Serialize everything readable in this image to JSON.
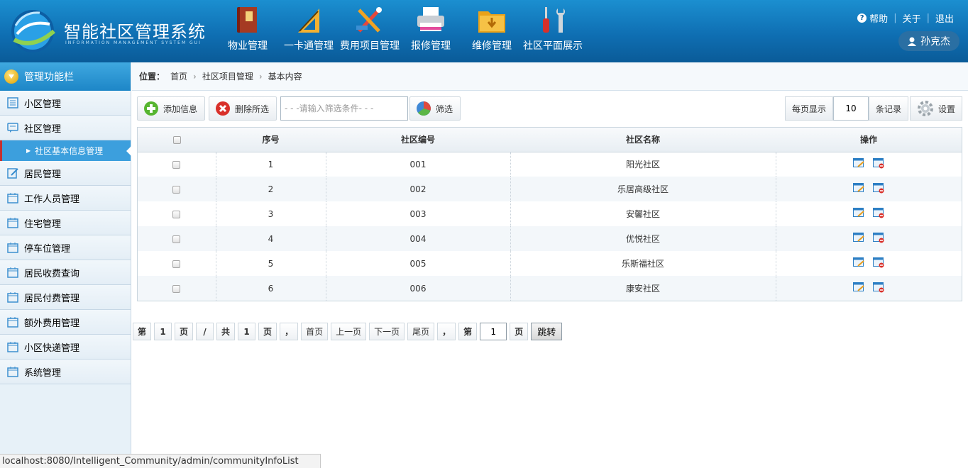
{
  "app": {
    "title": "智能社区管理系统",
    "subtitle": "INFORMATION MANAGEMENT SYSTEM GUI"
  },
  "topnav": [
    {
      "label": "物业管理",
      "icon": "book-icon"
    },
    {
      "label": "一卡通管理",
      "icon": "ruler-icon"
    },
    {
      "label": "费用项目管理",
      "icon": "tools-icon"
    },
    {
      "label": "报修管理",
      "icon": "printer-icon"
    },
    {
      "label": "维修管理",
      "icon": "folder-icon"
    },
    {
      "label": "社区平面展示",
      "icon": "screwdriver-icon"
    }
  ],
  "toplinks": {
    "help": "帮助",
    "about": "关于",
    "logout": "退出"
  },
  "user": {
    "name": "孙克杰"
  },
  "sidebar": {
    "title": "管理功能栏",
    "items": [
      {
        "label": "小区管理"
      },
      {
        "label": "社区管理"
      },
      {
        "label": "居民管理"
      },
      {
        "label": "工作人员管理"
      },
      {
        "label": "住宅管理"
      },
      {
        "label": "停车位管理"
      },
      {
        "label": "居民收费查询"
      },
      {
        "label": "居民付费管理"
      },
      {
        "label": "额外费用管理"
      },
      {
        "label": "小区快递管理"
      },
      {
        "label": "系统管理"
      }
    ],
    "active_sub": "社区基本信息管理"
  },
  "breadcrumb": {
    "label": "位置：",
    "items": [
      "首页",
      "社区项目管理",
      "基本内容"
    ]
  },
  "toolbar": {
    "add": "添加信息",
    "delete": "删除所选",
    "filter_placeholder": "- - -请输入筛选条件- - -",
    "filter": "筛选"
  },
  "perpage": {
    "label": "每页显示",
    "value": "10",
    "unit": "条记录",
    "settings": "设置"
  },
  "table": {
    "headers": [
      "序号",
      "社区编号",
      "社区名称",
      "操作"
    ],
    "rows": [
      {
        "seq": "1",
        "code": "001",
        "name": "阳光社区"
      },
      {
        "seq": "2",
        "code": "002",
        "name": "乐居高级社区"
      },
      {
        "seq": "3",
        "code": "003",
        "name": "安馨社区"
      },
      {
        "seq": "4",
        "code": "004",
        "name": "优悦社区"
      },
      {
        "seq": "5",
        "code": "005",
        "name": "乐斯福社区"
      },
      {
        "seq": "6",
        "code": "006",
        "name": "康安社区"
      }
    ]
  },
  "pager": {
    "di": "第",
    "current": "1",
    "ye": "页",
    "slash": "/",
    "gong": "共",
    "total": "1",
    "ye2": "页",
    "comma": "，",
    "first": "首页",
    "prev": "上一页",
    "next": "下一页",
    "last": "尾页",
    "comma2": "，",
    "di2": "第",
    "jump_value": "1",
    "ye3": "页",
    "go": "跳转"
  },
  "status_url": "localhost:8080/Intelligent_Community/admin/communityInfoList",
  "colors": {
    "header": "#0f6fb3",
    "sidebar_active": "#3c9fdd",
    "accent_red": "#c53030"
  }
}
